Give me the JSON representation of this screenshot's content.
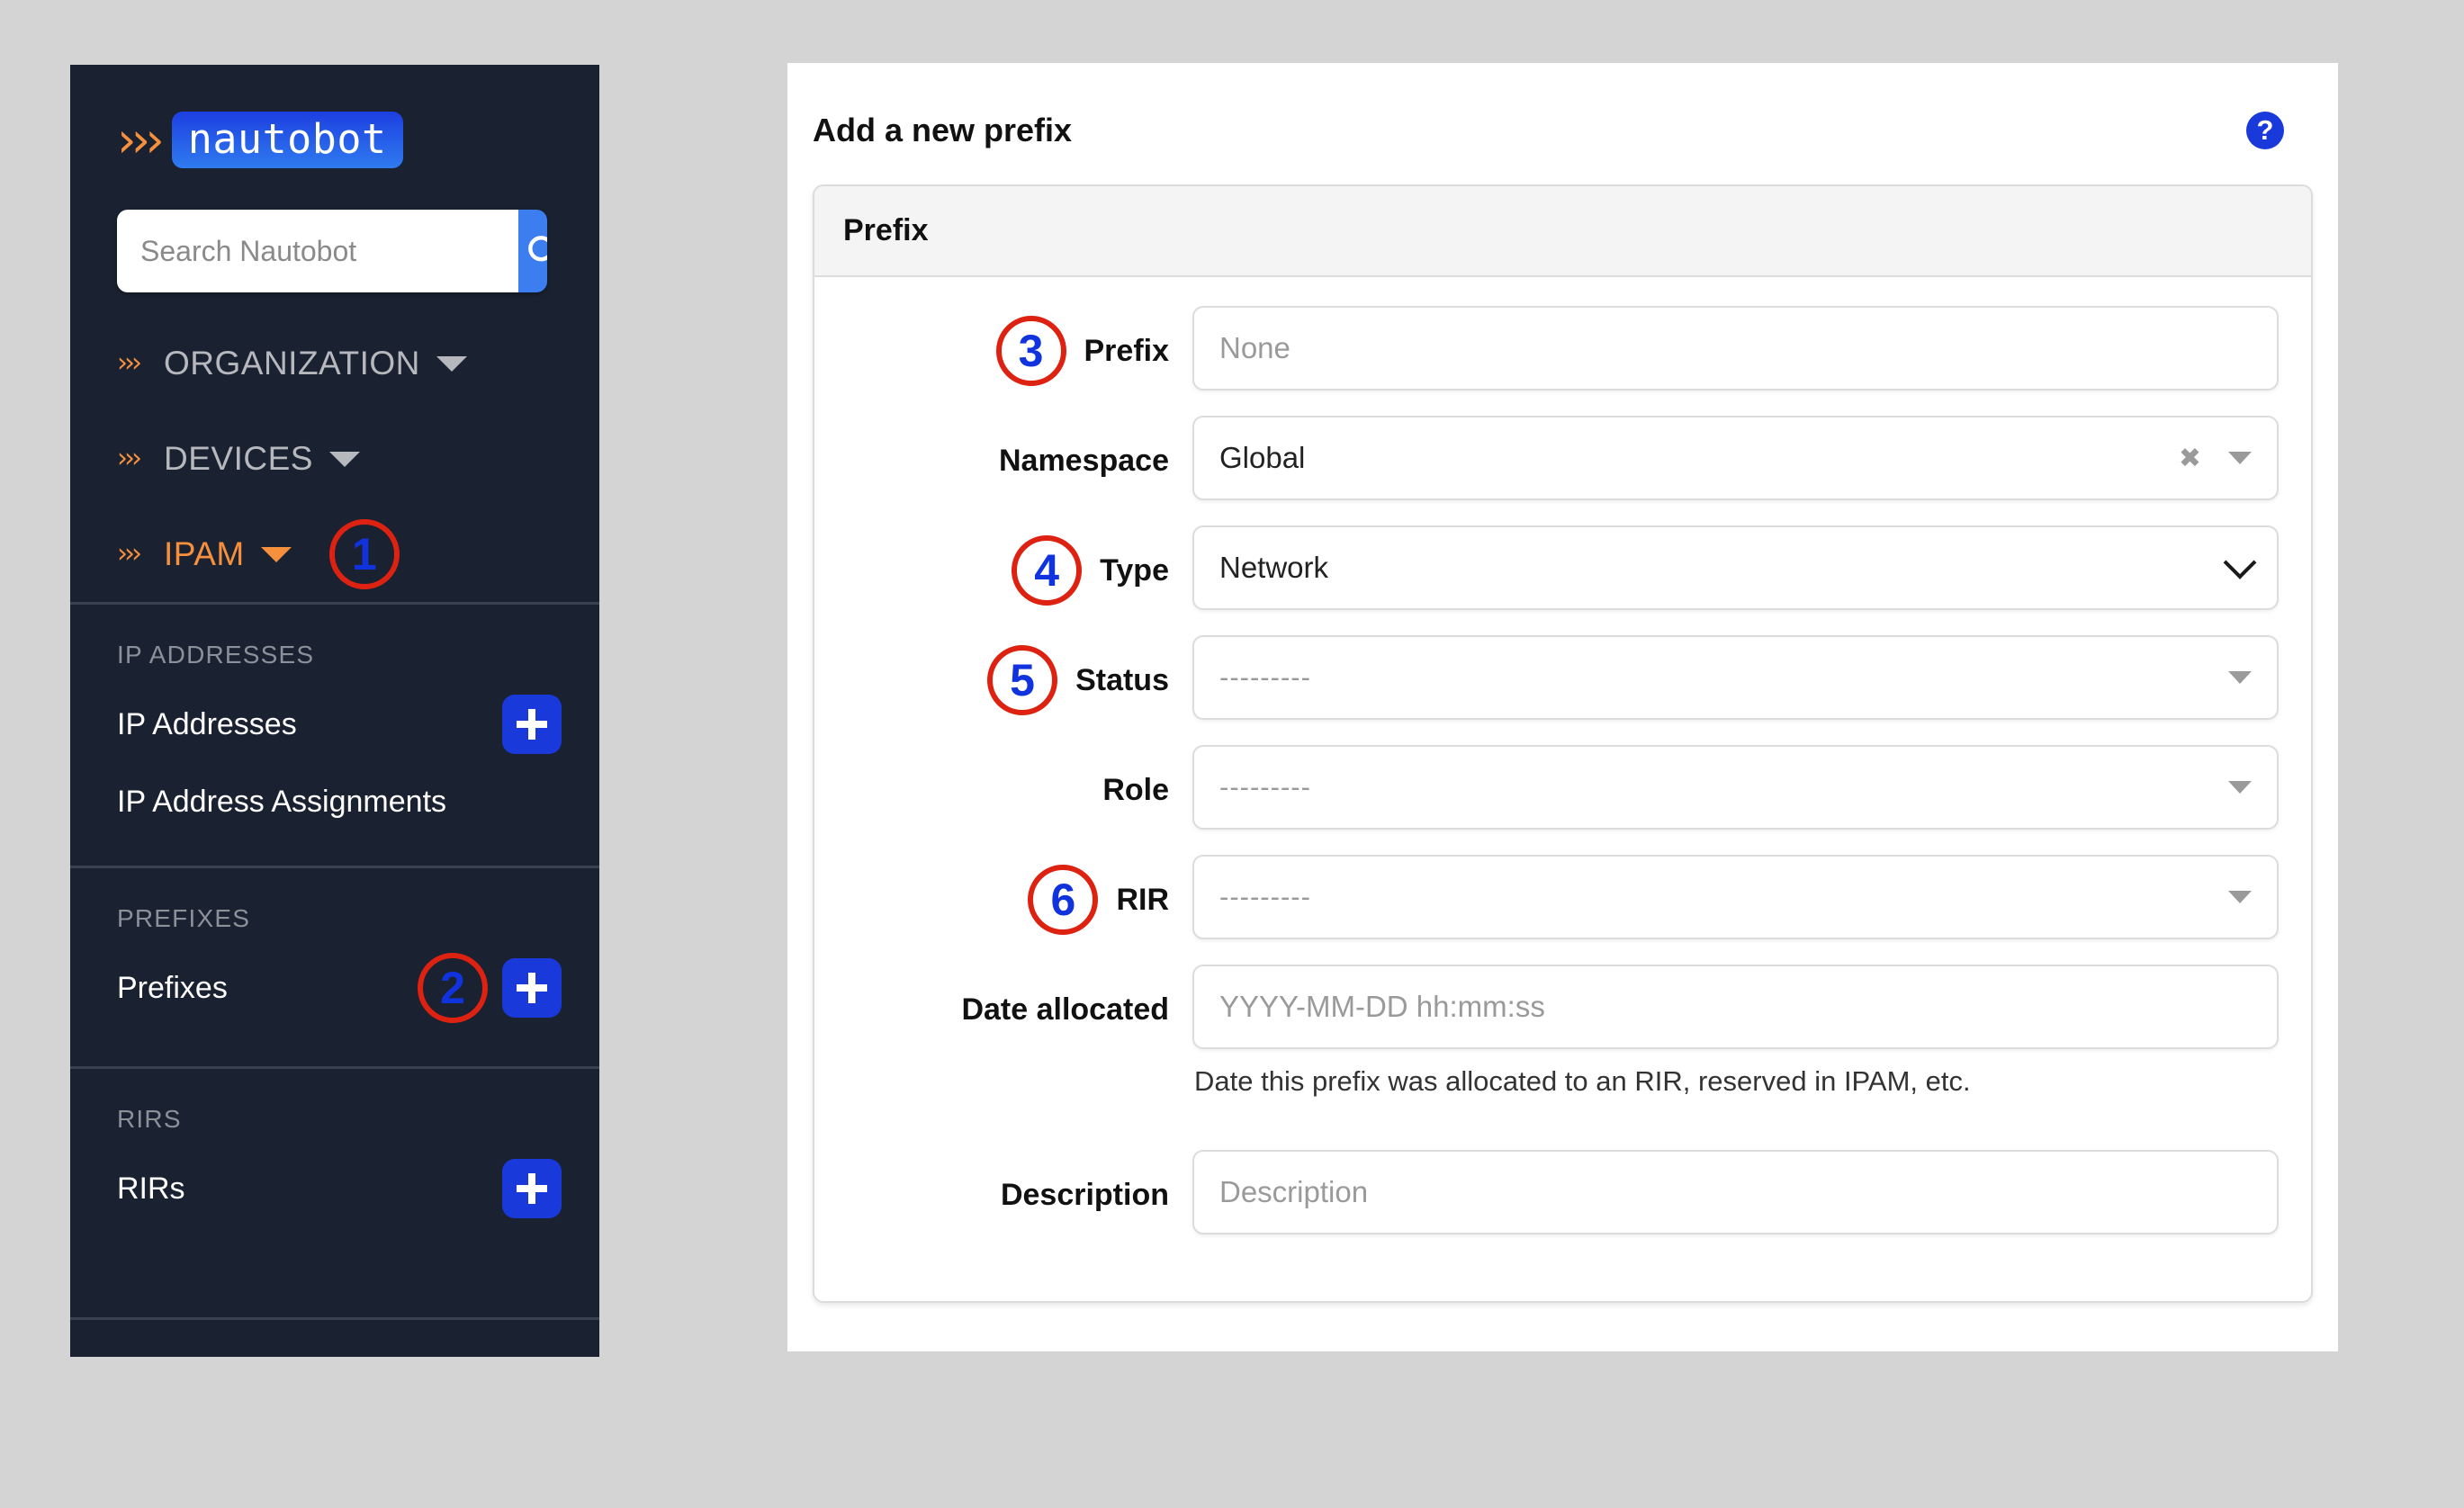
{
  "sidebar": {
    "brand": {
      "chevrons": "›››",
      "name": "nautobot"
    },
    "search": {
      "placeholder": "Search Nautobot",
      "value": "",
      "icon": "search-icon",
      "button_label": ""
    },
    "nav_groups": [
      {
        "label": "ORGANIZATION",
        "active": false,
        "marker": null
      },
      {
        "label": "DEVICES",
        "active": false,
        "marker": null
      },
      {
        "label": "IPAM",
        "active": true,
        "marker": "1"
      }
    ],
    "sections": [
      {
        "title": "IP ADDRESSES",
        "rows": [
          {
            "label": "IP Addresses",
            "has_add": true,
            "marker": null
          },
          {
            "label": "IP Address Assignments",
            "has_add": false,
            "marker": null
          }
        ]
      },
      {
        "title": "PREFIXES",
        "rows": [
          {
            "label": "Prefixes",
            "has_add": true,
            "marker": "2"
          }
        ]
      },
      {
        "title": "RIRS",
        "rows": [
          {
            "label": "RIRs",
            "has_add": true,
            "marker": null
          }
        ]
      }
    ]
  },
  "main": {
    "title": "Add a new prefix",
    "help_icon_label": "?",
    "card": {
      "header": "Prefix",
      "fields": [
        {
          "label": "Prefix",
          "marker": "3",
          "kind": "text",
          "value": "",
          "placeholder": "None"
        },
        {
          "label": "Namespace",
          "marker": null,
          "kind": "select2",
          "value": "Global",
          "placeholder": ""
        },
        {
          "label": "Type",
          "marker": "4",
          "kind": "native",
          "value": "Network",
          "placeholder": ""
        },
        {
          "label": "Status",
          "marker": "5",
          "kind": "select2",
          "value": "",
          "placeholder": "---------"
        },
        {
          "label": "Role",
          "marker": null,
          "kind": "select2",
          "value": "",
          "placeholder": "---------"
        },
        {
          "label": "RIR",
          "marker": "6",
          "kind": "select2",
          "value": "",
          "placeholder": "---------"
        },
        {
          "label": "Date allocated",
          "marker": null,
          "kind": "text",
          "value": "",
          "placeholder": "YYYY-MM-DD hh:mm:ss",
          "help": "Date this prefix was allocated to an RIR, reserved in IPAM, etc."
        },
        {
          "label": "Description",
          "marker": null,
          "kind": "text",
          "value": "",
          "placeholder": "Description"
        }
      ]
    }
  },
  "colors": {
    "sidebar_bg": "#1a2130",
    "accent_orange": "#f6903d",
    "accent_blue": "#1939db",
    "search_blue": "#3c7df0",
    "marker_ring": "#dd2211",
    "marker_text": "#1133dd"
  }
}
